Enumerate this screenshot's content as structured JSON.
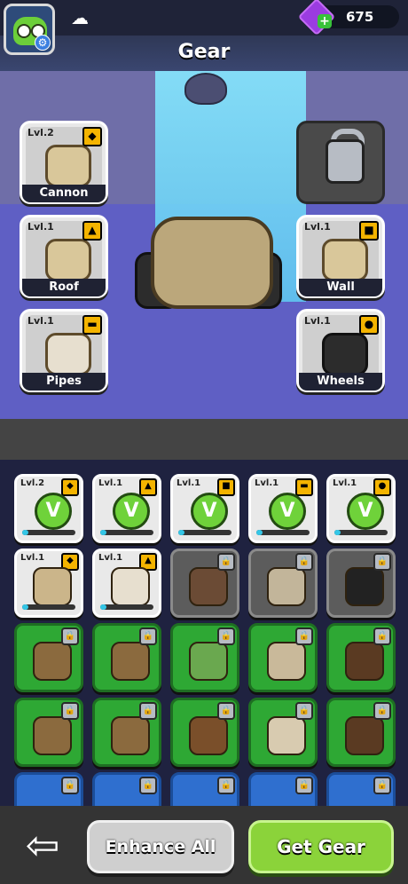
{
  "header": {
    "gem_count": "675",
    "title": "Gear"
  },
  "slots": [
    {
      "id": "cannon",
      "level": "Lvl.2",
      "name": "Cannon",
      "shape": "◆"
    },
    {
      "id": "roof",
      "level": "Lvl.1",
      "name": "Roof",
      "shape": "▲"
    },
    {
      "id": "pipes",
      "level": "Lvl.1",
      "name": "Pipes",
      "shape": "▬"
    },
    {
      "id": "wall",
      "level": "Lvl.1",
      "name": "Wall",
      "shape": "■"
    },
    {
      "id": "wheels",
      "level": "Lvl.1",
      "name": "Wheels",
      "shape": "●"
    }
  ],
  "grid": {
    "row1": [
      {
        "level": "Lvl.2",
        "badge": "◆",
        "check": "V"
      },
      {
        "level": "Lvl.1",
        "badge": "▲",
        "check": "V"
      },
      {
        "level": "Lvl.1",
        "badge": "■",
        "check": "V"
      },
      {
        "level": "Lvl.1",
        "badge": "▬",
        "check": "V"
      },
      {
        "level": "Lvl.1",
        "badge": "●",
        "check": "V"
      }
    ],
    "row2": [
      {
        "level": "Lvl.1",
        "badge": "◆"
      },
      {
        "level": "Lvl.1",
        "badge": "▲"
      }
    ]
  },
  "buttons": {
    "enhance_all": "Enhance All",
    "get_gear": "Get Gear",
    "back": "⇦"
  },
  "colors": {
    "accent_green": "#8bd33a",
    "stage_bg": "#6f6ea8",
    "highlight_blue": "#86e8ff"
  }
}
